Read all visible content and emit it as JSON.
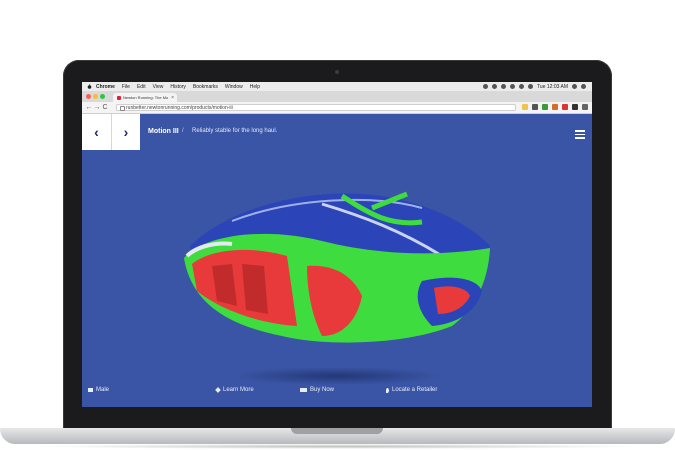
{
  "macos": {
    "menu": [
      "Chrome",
      "File",
      "Edit",
      "View",
      "History",
      "Bookmarks",
      "Window",
      "Help"
    ],
    "clock": "Tue 12:03 AM"
  },
  "browser": {
    "tab_title": "Newton Running: The Moti",
    "tab_close": "×",
    "url": "runbetter.newtonrunning.com/products/motion-iii",
    "back": "←",
    "forward": "→",
    "reload": "C"
  },
  "site": {
    "prev": "‹",
    "next": "›",
    "product_name": "Motion III",
    "separator": "/",
    "tagline": "Reliably stable for the long haul."
  },
  "bottom_nav": {
    "gender": "Male",
    "learn_more": "Learn More",
    "buy_now": "Buy Now",
    "locate": "Locate a Retailer"
  },
  "colors": {
    "screen_bg": "#3a55a5",
    "shoe_blue": "#2b45b8",
    "shoe_green": "#3fdc3f",
    "shoe_red": "#e83a3a"
  }
}
